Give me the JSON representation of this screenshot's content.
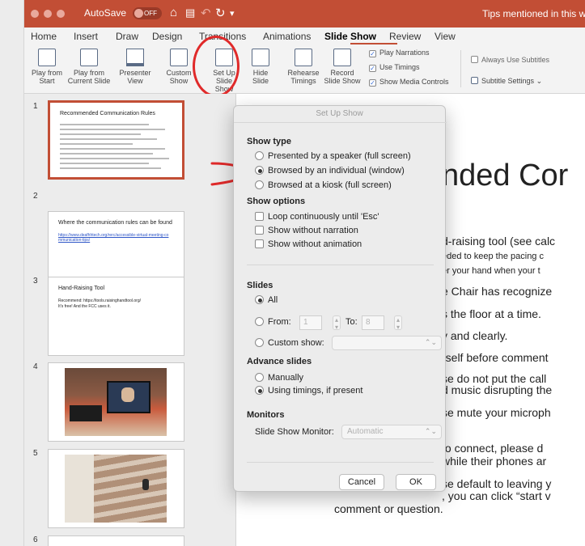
{
  "titlebar": {
    "autosave_label": "AutoSave",
    "autosave_state": "OFF",
    "doc_title": "Tips mentioned in this webinar"
  },
  "menu_tabs": [
    "Home",
    "Insert",
    "Draw",
    "Design",
    "Transitions",
    "Animations",
    "Slide Show",
    "Review",
    "View"
  ],
  "ribbon": {
    "play_from_start": "Play from Start",
    "play_from_current": "Play from Current Slide",
    "presenter_view": "Presenter View",
    "custom_show": "Custom Show",
    "setup_slideshow": "Set Up Slide Show",
    "hide_slide": "Hide Slide",
    "rehearse_timings": "Rehearse Timings",
    "record_slideshow": "Record Slide Show",
    "play_narrations": "Play Narrations",
    "use_timings": "Use Timings",
    "show_media_controls": "Show Media Controls",
    "always_use_subtitles": "Always Use Subtitles",
    "subtitle_settings": "Subtitle Settings"
  },
  "slides": [
    {
      "num": "1",
      "title": "Recommended Communication Rules"
    },
    {
      "num": "2",
      "title": "Where the communication rules can be found",
      "link": "https://www.deafhhtech.org/rerc/accessible-virtual-meeting-communication-tips/"
    },
    {
      "num": "3",
      "title": "Hand-Raising Tool",
      "link": "Recommend: https://tools.raisinghandtool.org/",
      "note": "It's free! And the FCC uses it."
    },
    {
      "num": "4"
    },
    {
      "num": "5"
    },
    {
      "num": "6"
    }
  ],
  "main_slide": {
    "title": "nded Cor",
    "lines": [
      "d-raising tool (see calc",
      "eded to keep the pacing c",
      "er your hand when your t",
      "e Chair has recognize",
      "s the floor at a time.",
      "y and clearly.",
      "rself before comment",
      "se do not put the call",
      "d music disrupting the",
      "se mute your microph",
      "to connect, please d",
      "while their phones ar",
      "se default to leaving y",
      ", you can click “start v",
      "comment or question."
    ]
  },
  "dialog": {
    "title": "Set Up Show",
    "show_type_heading": "Show type",
    "show_type_options": [
      {
        "label": "Presented by a speaker (full screen)",
        "selected": false
      },
      {
        "label": "Browsed by an individual (window)",
        "selected": true
      },
      {
        "label": "Browsed at a kiosk (full screen)",
        "selected": false
      }
    ],
    "show_options_heading": "Show options",
    "show_options": [
      {
        "label": "Loop continuously until 'Esc'",
        "checked": false
      },
      {
        "label": "Show without narration",
        "checked": false
      },
      {
        "label": "Show without animation",
        "checked": false
      }
    ],
    "slides_heading": "Slides",
    "slides_all": "All",
    "slides_from": "From:",
    "from_value": "1",
    "to_label": "To:",
    "to_value": "8",
    "custom_show": "Custom show:",
    "advance_heading": "Advance slides",
    "advance_options": [
      {
        "label": "Manually",
        "selected": false
      },
      {
        "label": "Using timings, if present",
        "selected": true
      }
    ],
    "monitors_heading": "Monitors",
    "monitor_label": "Slide Show Monitor:",
    "monitor_value": "Automatic",
    "cancel": "Cancel",
    "ok": "OK"
  },
  "colors": {
    "accent": "#c24e35",
    "annotation": "#e02a2a",
    "link": "#2d55c7"
  }
}
